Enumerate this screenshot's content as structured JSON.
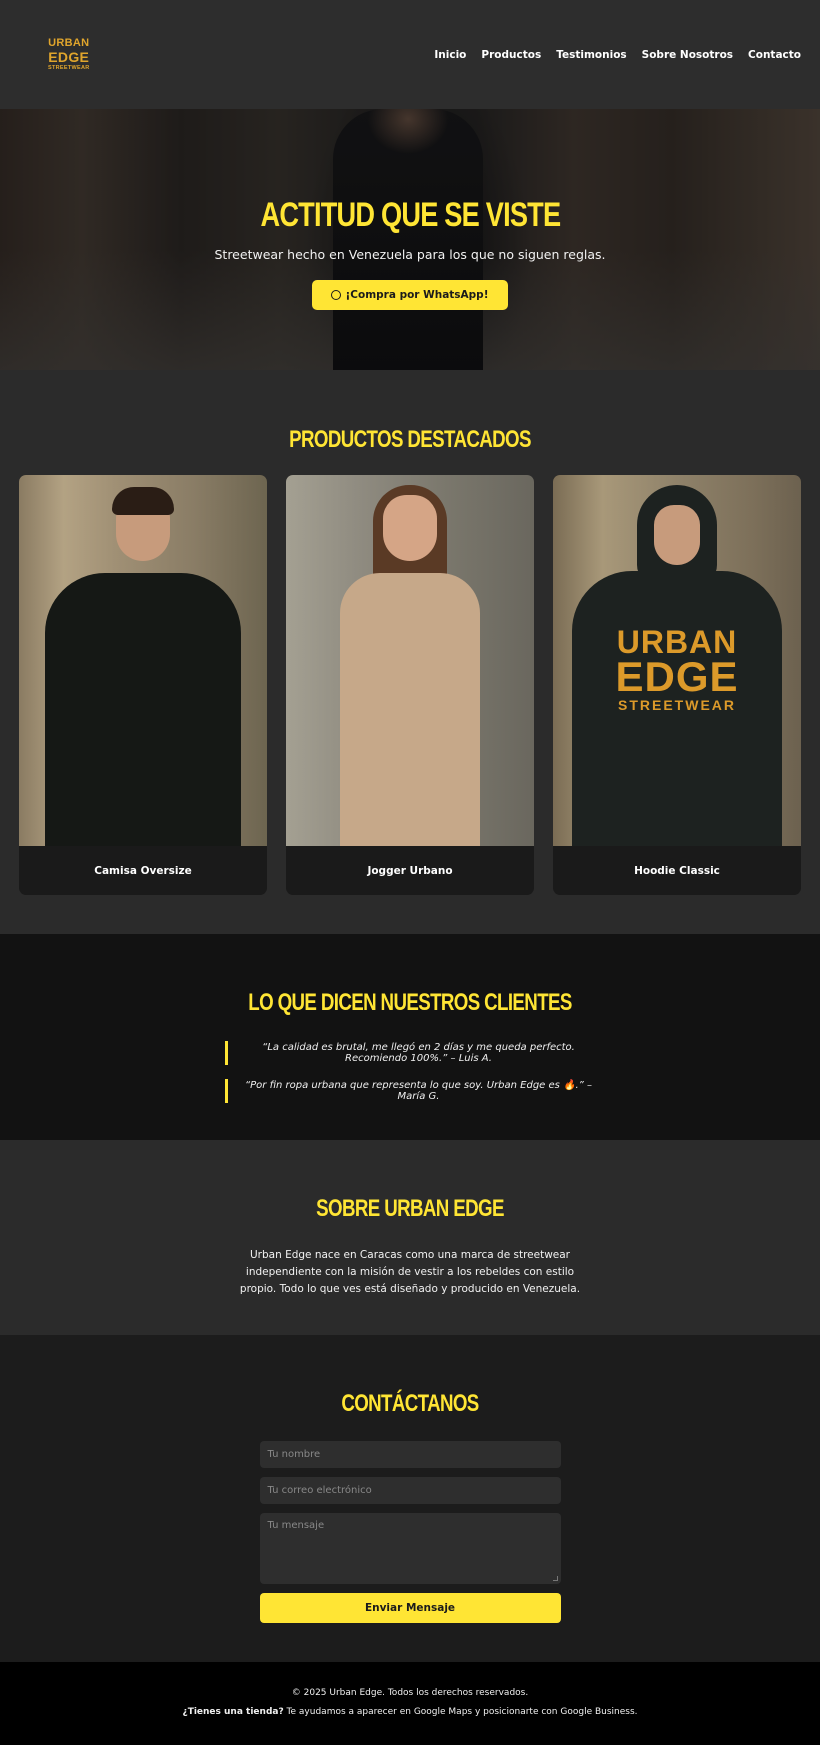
{
  "brand": {
    "line1": "URBAN",
    "line2": "EDGE",
    "line3": "STREETWEAR"
  },
  "nav": {
    "items": [
      "Inicio",
      "Productos",
      "Testimonios",
      "Sobre Nosotros",
      "Contacto"
    ]
  },
  "hero": {
    "title": "ACTITUD QUE SE VISTE",
    "subtitle": "Streetwear hecho en Venezuela para los que no siguen reglas.",
    "cta_label": "¡Compra por WhatsApp!",
    "cta_icon": "whatsapp-icon"
  },
  "products": {
    "title": "PRODUCTOS DESTACADOS",
    "items": [
      {
        "name": "Camisa Oversize"
      },
      {
        "name": "Jogger Urbano"
      },
      {
        "name": "Hoodie Classic",
        "print": [
          "URBAN",
          "EDGE",
          "STREETWEAR"
        ]
      }
    ]
  },
  "testimonials": {
    "title": "LO QUE DICEN NUESTROS CLIENTES",
    "quotes": [
      "“La calidad es brutal, me llegó en 2 días y me queda perfecto. Recomiendo 100%.” – Luis A.",
      "“Por fin ropa urbana que representa lo que soy. Urban Edge es 🔥.” – María G."
    ]
  },
  "about": {
    "title": "SOBRE URBAN EDGE",
    "text": "Urban Edge nace en Caracas como una marca de streetwear independiente con la misión de vestir a los rebeldes con estilo propio. Todo lo que ves está diseñado y producido en Venezuela."
  },
  "contact": {
    "title": "CONTÁCTANOS",
    "name_placeholder": "Tu nombre",
    "email_placeholder": "Tu correo electrónico",
    "message_placeholder": "Tu mensaje",
    "submit_label": "Enviar Mensaje"
  },
  "footer": {
    "copyright": "© 2025 Urban Edge. Todos los derechos reservados.",
    "cta_bold": "¿Tienes una tienda?",
    "cta_text": " Te ayudamos a aparecer en Google Maps y posicionarte con Google Business."
  },
  "colors": {
    "accent": "#ffe534",
    "logo": "#e0a52c",
    "background": "#2b2b2b",
    "dark": "#121212"
  }
}
